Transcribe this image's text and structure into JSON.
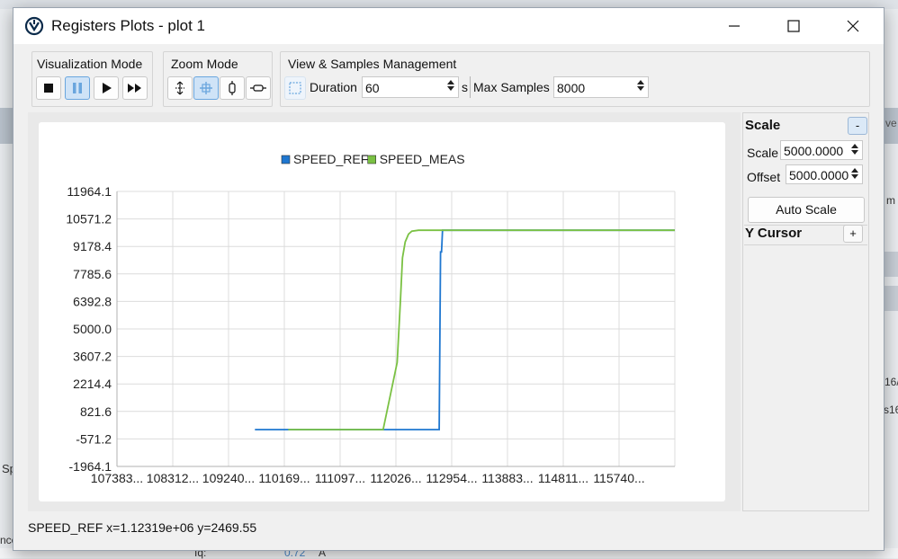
{
  "window": {
    "title": "Registers Plots - plot 1",
    "accent_color": "#0078d4"
  },
  "toolbar": {
    "visualization": {
      "title": "Visualization Mode",
      "buttons": [
        {
          "name": "stop",
          "icon": "stop-icon"
        },
        {
          "name": "pause",
          "icon": "pause-icon",
          "active": true
        },
        {
          "name": "play",
          "icon": "play-icon"
        },
        {
          "name": "fast-forward",
          "icon": "fast-forward-icon"
        }
      ]
    },
    "zoom": {
      "title": "Zoom Mode",
      "buttons": [
        {
          "name": "zoom-xy",
          "icon": "zoom-xy-icon"
        },
        {
          "name": "zoom-box",
          "icon": "zoom-box-icon",
          "active": true
        },
        {
          "name": "zoom-vertical",
          "icon": "zoom-vertical-icon"
        },
        {
          "name": "zoom-horizontal",
          "icon": "zoom-horizontal-icon"
        }
      ]
    },
    "samples": {
      "title": "View & Samples Management",
      "duration_label": "Duration",
      "duration_value": "60",
      "duration_unit": "s",
      "max_samples_label": "Max Samples",
      "max_samples_value": "8000"
    }
  },
  "side": {
    "scale_header": "Scale",
    "collapse_label": "-",
    "scale_label": "Scale",
    "scale_value": "5000.0000",
    "offset_label": "Offset",
    "offset_value": "5000.0000",
    "auto_scale_label": "Auto Scale",
    "y_cursor_header": "Y Cursor",
    "add_label": "+"
  },
  "status_text": "SPEED_REF x=1.12319e+06 y=2469.55",
  "background": {
    "text_a": "Sp",
    "text_b": "nce",
    "text_c": "Iq:",
    "text_d": "0.72",
    "text_e": "A",
    "text_f": "ve",
    "text_g": "m",
    "text_h": "16/",
    "text_i": "s16"
  },
  "chart_data": {
    "type": "line",
    "legend": [
      "SPEED_REF",
      "SPEED_MEAS"
    ],
    "legend_position": "top-center",
    "grid": true,
    "ylim": [
      -1964.1,
      11964.1
    ],
    "xlim": [
      1073830,
      1157400
    ],
    "y_ticks": [
      "11964.1",
      "10571.2",
      "9178.4",
      "7785.6",
      "6392.8",
      "5000.0",
      "3607.2",
      "2214.4",
      "821.6",
      "-571.2",
      "-1964.1"
    ],
    "x_ticks": [
      "107383...",
      "108312...",
      "109240...",
      "110169...",
      "111097...",
      "112026...",
      "112954...",
      "113883...",
      "114811...",
      "115740..."
    ],
    "series": [
      {
        "name": "SPEED_REF",
        "color": "#1f77d0",
        "x": [
          1094500,
          1099500,
          1112000,
          1122100,
          1122300,
          1122450,
          1122600,
          1157400
        ],
        "y": [
          -100,
          -100,
          -100,
          -100,
          8900,
          8900,
          10000,
          10000
        ]
      },
      {
        "name": "SPEED_MEAS",
        "color": "#7ac143",
        "x": [
          1099500,
          1112000,
          1113700,
          1115800,
          1116300,
          1116600,
          1117000,
          1117500,
          1118000,
          1119000,
          1157400
        ],
        "y": [
          -100,
          -100,
          -100,
          3300,
          6500,
          8600,
          9400,
          9800,
          9950,
          10000,
          10000
        ]
      }
    ]
  }
}
